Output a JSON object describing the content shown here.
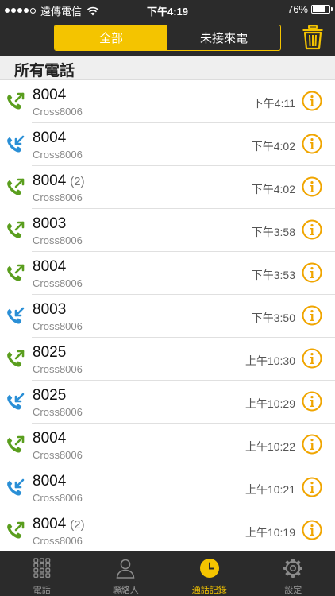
{
  "status_bar": {
    "carrier": "遠傳電信",
    "time": "下午4:19",
    "battery_text": "76%",
    "battery_level": 0.76
  },
  "segment": {
    "all_label": "全部",
    "missed_label": "未接來電"
  },
  "section": {
    "title": "所有電話"
  },
  "calls": [
    {
      "name": "8004",
      "count": "",
      "sub": "Cross8006",
      "time": "下午4:11",
      "direction": "outgoing"
    },
    {
      "name": "8004",
      "count": "",
      "sub": "Cross8006",
      "time": "下午4:02",
      "direction": "incoming"
    },
    {
      "name": "8004",
      "count": "(2)",
      "sub": "Cross8006",
      "time": "下午4:02",
      "direction": "outgoing"
    },
    {
      "name": "8003",
      "count": "",
      "sub": "Cross8006",
      "time": "下午3:58",
      "direction": "outgoing"
    },
    {
      "name": "8004",
      "count": "",
      "sub": "Cross8006",
      "time": "下午3:53",
      "direction": "outgoing"
    },
    {
      "name": "8003",
      "count": "",
      "sub": "Cross8006",
      "time": "下午3:50",
      "direction": "incoming"
    },
    {
      "name": "8025",
      "count": "",
      "sub": "Cross8006",
      "time": "上午10:30",
      "direction": "outgoing"
    },
    {
      "name": "8025",
      "count": "",
      "sub": "Cross8006",
      "time": "上午10:29",
      "direction": "incoming"
    },
    {
      "name": "8004",
      "count": "",
      "sub": "Cross8006",
      "time": "上午10:22",
      "direction": "outgoing"
    },
    {
      "name": "8004",
      "count": "",
      "sub": "Cross8006",
      "time": "上午10:21",
      "direction": "incoming"
    },
    {
      "name": "8004",
      "count": "(2)",
      "sub": "Cross8006",
      "time": "上午10:19",
      "direction": "outgoing"
    }
  ],
  "tabs": [
    {
      "label": "電話",
      "icon": "keypad-icon",
      "active": false
    },
    {
      "label": "聯絡人",
      "icon": "contacts-icon",
      "active": false
    },
    {
      "label": "通話記錄",
      "icon": "clock-icon",
      "active": true
    },
    {
      "label": "設定",
      "icon": "gear-icon",
      "active": false
    }
  ],
  "colors": {
    "accent": "#f4c400",
    "outgoing": "#5a9e1e",
    "incoming": "#2a8fd6",
    "info": "#f0a500",
    "bar": "#2b2b2b"
  }
}
